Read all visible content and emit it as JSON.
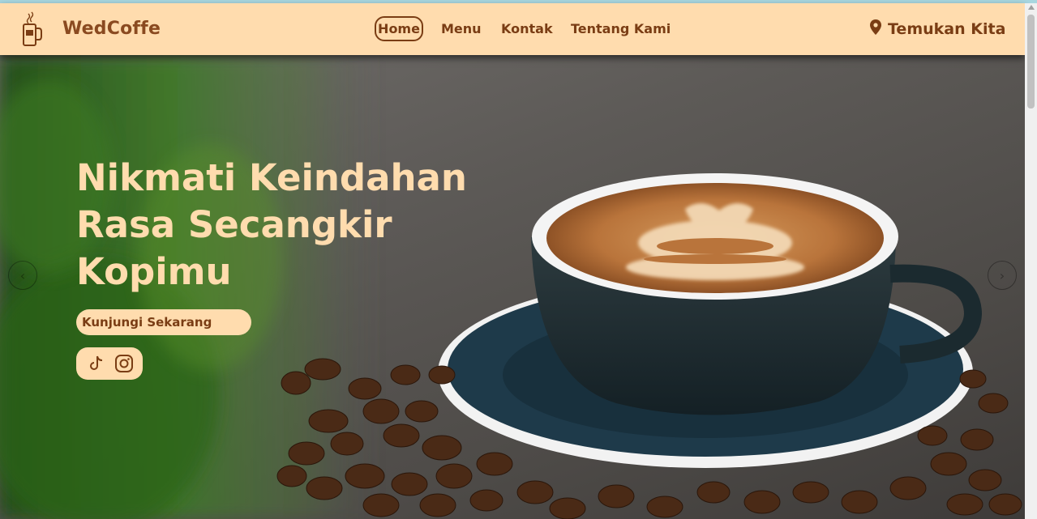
{
  "brand": {
    "name": "WedCoffe",
    "icon": "coffee-cup-icon"
  },
  "nav": {
    "home": "Home",
    "menu": "Menu",
    "contact": "Kontak",
    "about": "Tentang Kami",
    "find_us": "Temukan Kita",
    "find_us_icon": "map-pin-icon"
  },
  "hero": {
    "title": "Nikmati Keindahan Rasa Secangkir Kopimu",
    "cta": "Kunjungi Sekarang",
    "social_icons": [
      "tiktok-icon",
      "instagram-icon"
    ]
  },
  "carousel": {
    "prev_icon": "chevron-left-icon",
    "next_icon": "chevron-right-icon"
  },
  "colors": {
    "navbar_bg": "#ffdcae",
    "brand_brown": "#7a3d14",
    "hero_text": "#ffdcae",
    "top_strip": "#a8d6df"
  }
}
